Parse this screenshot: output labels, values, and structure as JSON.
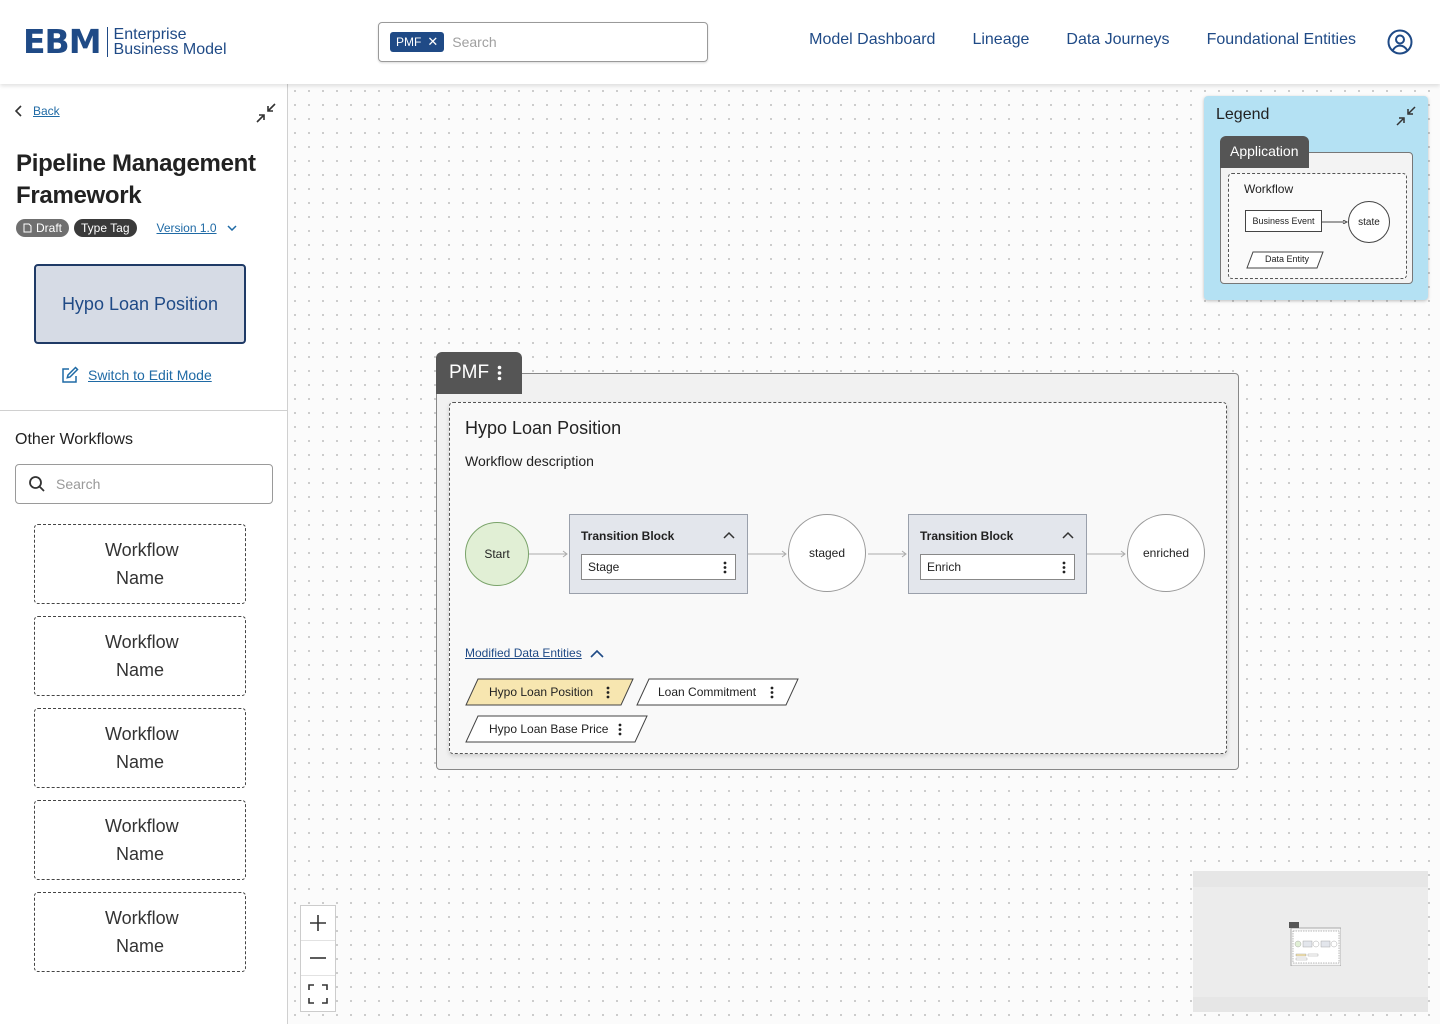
{
  "brand": {
    "mark": "EBM",
    "line1": "Enterprise",
    "line2": "Business Model",
    "color": "#1f4a86"
  },
  "top_search": {
    "chip": "PMF",
    "placeholder": "Search"
  },
  "nav": {
    "items": [
      "Model Dashboard",
      "Lineage",
      "Data Journeys",
      "Foundational Entities"
    ]
  },
  "sidebar": {
    "back_label": "Back",
    "title": "Pipeline Management Framework",
    "tag_draft": "Draft",
    "tag_type": "Type Tag",
    "version": "Version 1.0",
    "current_workflow": "Hypo Loan Position",
    "edit_mode_label": "Switch to Edit Mode",
    "other_title": "Other Workflows",
    "search_placeholder": "Search",
    "workflows": [
      "Workflow Name",
      "Workflow Name",
      "Workflow Name",
      "Workflow Name",
      "Workflow Name"
    ]
  },
  "legend": {
    "title": "Legend",
    "application": "Application",
    "workflow": "Workflow",
    "business_event": "Business Event",
    "state": "state",
    "data_entity": "Data Entity",
    "bg_color": "#b4e1f3"
  },
  "pmf": {
    "tab_label": "PMF",
    "workflow_title": "Hypo Loan Position",
    "workflow_description": "Workflow description",
    "start_label": "Start",
    "block1_title": "Transition Block",
    "block1_field": "Stage",
    "state1": "staged",
    "block2_title": "Transition Block",
    "block2_field": "Enrich",
    "state2": "enriched",
    "modified_link": "Modified Data Entities",
    "entities": [
      "Hypo Loan Position",
      "Loan Commitment",
      "Hypo Loan Base Price"
    ],
    "highlight_color": "#f7e6b0"
  }
}
